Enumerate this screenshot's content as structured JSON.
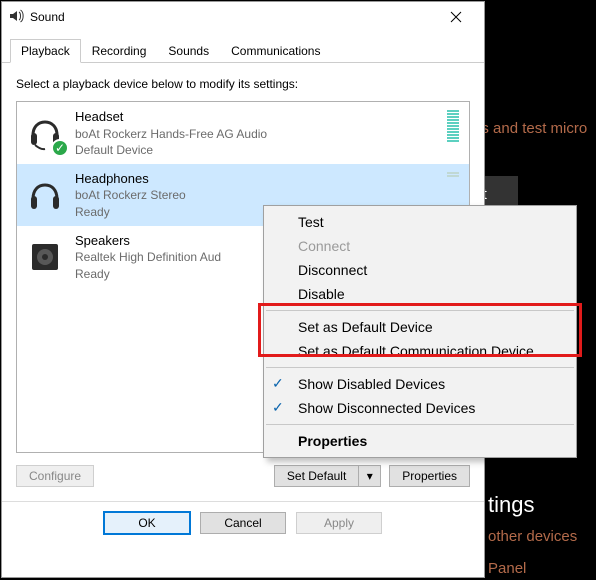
{
  "bg": {
    "link1": "es and test micro",
    "troubleshoot_btn": "oot",
    "heading_settings": "tings",
    "link2": "other devices",
    "link3": "Panel"
  },
  "window": {
    "title": "Sound",
    "tabs": [
      "Playback",
      "Recording",
      "Sounds",
      "Communications"
    ],
    "active_tab": 0,
    "instruction": "Select a playback device below to modify its settings:",
    "devices": [
      {
        "name": "Headset",
        "sub": "boAt Rockerz Hands-Free AG Audio",
        "status": "Default Device",
        "default": true
      },
      {
        "name": "Headphones",
        "sub": "boAt Rockerz Stereo",
        "status": "Ready"
      },
      {
        "name": "Speakers",
        "sub": "Realtek High Definition Aud",
        "status": "Ready"
      }
    ],
    "selected_device": 1,
    "buttons": {
      "configure": "Configure",
      "set_default": "Set Default",
      "properties": "Properties",
      "ok": "OK",
      "cancel": "Cancel",
      "apply": "Apply"
    }
  },
  "context_menu": {
    "test": "Test",
    "connect": "Connect",
    "disconnect": "Disconnect",
    "disable": "Disable",
    "set_default_device": "Set as Default Device",
    "set_default_comm": "Set as Default Communication Device",
    "show_disabled": "Show Disabled Devices",
    "show_disconnected": "Show Disconnected Devices",
    "properties": "Properties"
  }
}
